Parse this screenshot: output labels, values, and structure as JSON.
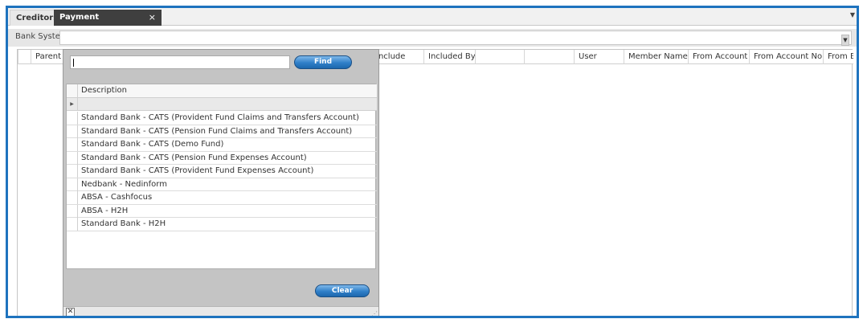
{
  "tabs": [
    {
      "label": "Creditors"
    },
    {
      "label": "Payment Management",
      "active": true
    }
  ],
  "icons": {
    "tab_close": "×",
    "dropdown": "▼",
    "row_indicator": "▶",
    "popup_close": "✕",
    "resize_grip": "⋰"
  },
  "bank_system": {
    "label": "Bank System",
    "value": ""
  },
  "grid": {
    "columns": [
      {
        "label": "Parent"
      },
      {
        "label": "Include"
      },
      {
        "label": "Included By"
      },
      {
        "label": ""
      },
      {
        "label": ""
      },
      {
        "label": "User"
      },
      {
        "label": "Member Name"
      },
      {
        "label": "From Account"
      },
      {
        "label": "From Account No"
      },
      {
        "label": "From Br"
      }
    ]
  },
  "popup": {
    "search_value": "",
    "find_label": "Find",
    "clear_label": "Clear",
    "list_header": "Description",
    "items": [
      "Standard Bank - CATS (Provident Fund Claims and Transfers Account)",
      "Standard Bank - CATS (Pension Fund Claims and Transfers Account)",
      "Standard Bank - CATS (Demo Fund)",
      "Standard Bank - CATS (Pension Fund Expenses Account)",
      "Standard Bank - CATS (Provident Fund Expenses Account)",
      "Nedbank - Nedinform",
      "ABSA - Cashfocus",
      "ABSA - H2H",
      "Standard Bank - H2H"
    ]
  },
  "colors": {
    "accent_border": "#1e73be",
    "active_tab": "#3f3f3f",
    "button": "#2f7fc8"
  }
}
